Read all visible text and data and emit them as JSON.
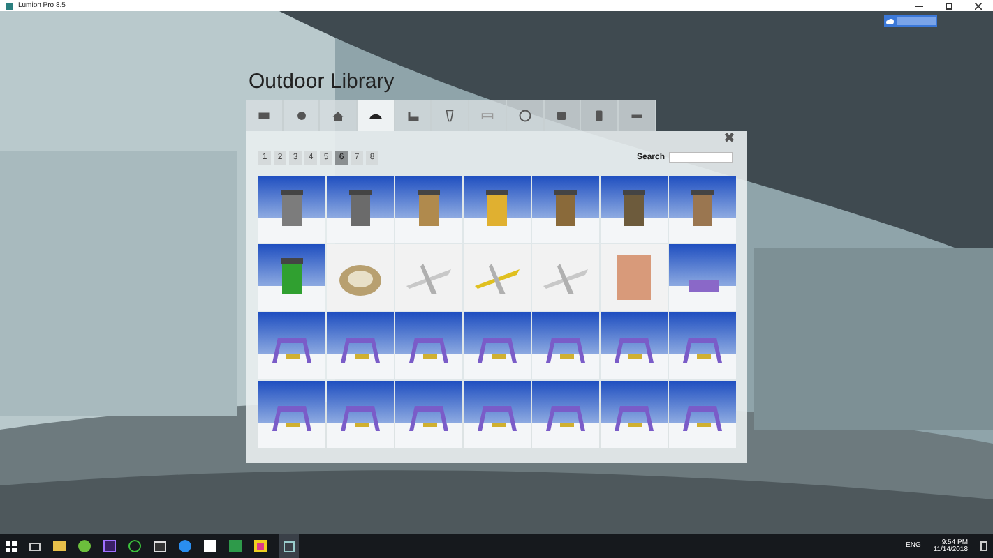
{
  "window": {
    "title": "Lumion Pro 8.5"
  },
  "library": {
    "title": "Outdoor Library",
    "tabs": [
      {
        "selected": false
      },
      {
        "selected": false
      },
      {
        "selected": false
      },
      {
        "selected": true
      },
      {
        "selected": false
      },
      {
        "selected": false
      },
      {
        "selected": false
      },
      {
        "selected": false
      },
      {
        "selected": false
      },
      {
        "selected": false
      },
      {
        "selected": false
      }
    ],
    "pages": [
      {
        "label": "1",
        "selected": false
      },
      {
        "label": "2",
        "selected": false
      },
      {
        "label": "3",
        "selected": false
      },
      {
        "label": "4",
        "selected": false
      },
      {
        "label": "5",
        "selected": false
      },
      {
        "label": "6",
        "selected": true
      },
      {
        "label": "7",
        "selected": false
      },
      {
        "label": "8",
        "selected": false
      }
    ],
    "close": "✖",
    "search": {
      "label": "Search"
    }
  },
  "taskbar": {
    "language": "ENG",
    "time": "9:54 PM",
    "date": "11/14/2018"
  }
}
